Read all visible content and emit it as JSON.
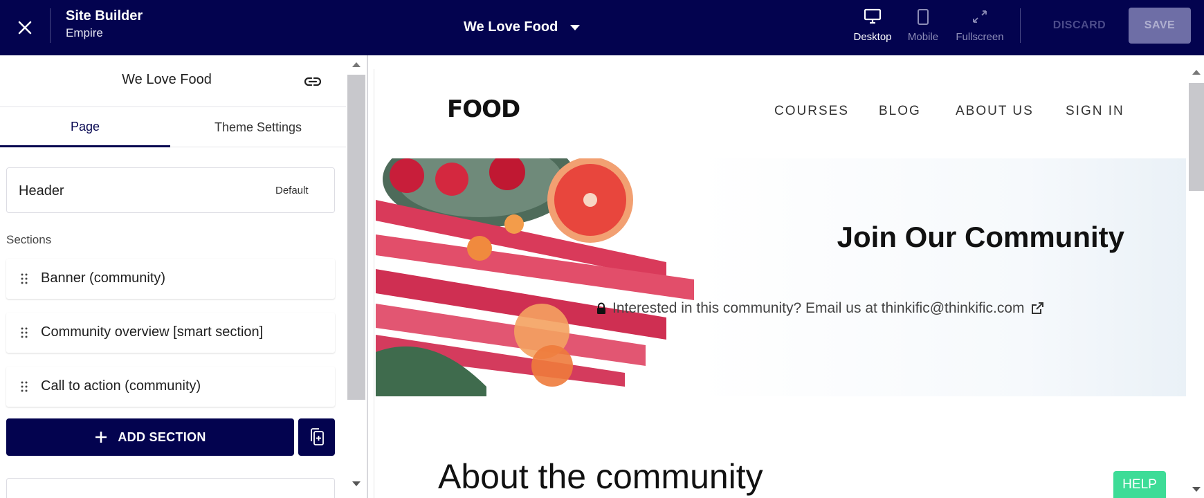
{
  "app": {
    "title": "Site Builder",
    "subtitle": "Empire",
    "page_selector": "We Love Food"
  },
  "views": {
    "desktop": "Desktop",
    "mobile": "Mobile",
    "fullscreen": "Fullscreen"
  },
  "actions": {
    "discard": "DISCARD",
    "save": "SAVE"
  },
  "panel": {
    "page_name": "We Love Food",
    "tabs": [
      "Page",
      "Theme Settings"
    ],
    "header": {
      "label": "Header",
      "value": "Default"
    },
    "sections_label": "Sections",
    "sections": [
      "Banner (community)",
      "Community overview [smart section]",
      "Call to action (community)"
    ],
    "add_section": "ADD SECTION"
  },
  "preview": {
    "logo": "FOOD",
    "nav": [
      "COURSES",
      "BLOG",
      "ABOUT US",
      "SIGN IN"
    ],
    "banner_title": "Join Our Community",
    "banner_text": "Interested in this community? Email us at thinkific@thinkific.com",
    "about_title": "About the community"
  },
  "help": "HELP",
  "colors": {
    "brand_navy": "#03034f",
    "help_green": "#3ddc97"
  }
}
